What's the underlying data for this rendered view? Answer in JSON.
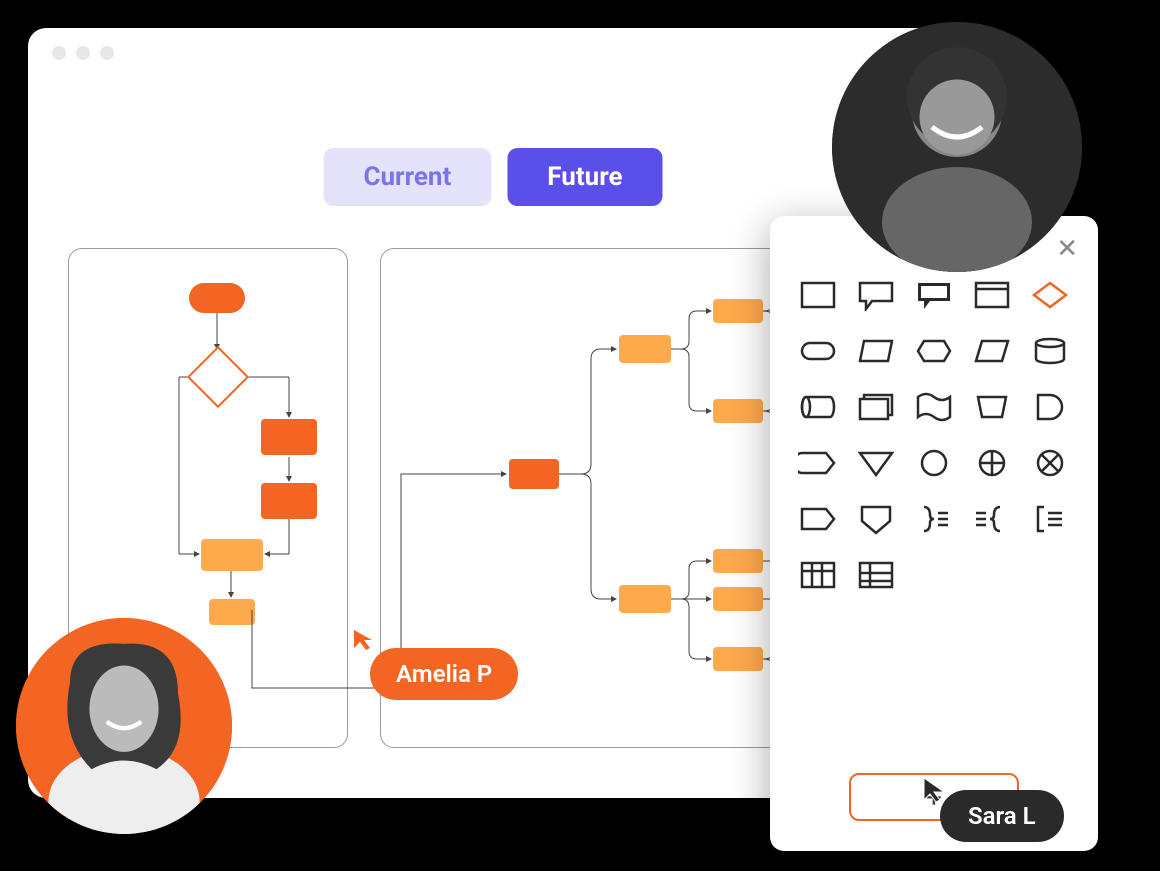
{
  "tabs": {
    "current": "Current",
    "future": "Future"
  },
  "cursors": {
    "amelia": "Amelia P",
    "sara": "Sara L"
  },
  "shapePanel": {
    "addLabel": "+",
    "closeLabel": "✕",
    "shapes": [
      "rectangle",
      "speech-bubble",
      "speech-bubble-filled",
      "card",
      "diamond",
      "rounded-rect",
      "trapezoid",
      "hexagon",
      "parallelogram",
      "cylinder",
      "can",
      "document-stack",
      "flag",
      "bucket",
      "half-circle",
      "tag",
      "triangle-down",
      "circle",
      "circle-cross",
      "circle-x",
      "pentagon-tag",
      "shield",
      "brace-right",
      "brace-left",
      "bracket",
      "grid-vertical",
      "grid-horizontal"
    ]
  },
  "avatars": {
    "top": "collaborator-1",
    "bottom": "collaborator-2"
  },
  "colors": {
    "accent": "#F26522",
    "primary": "#5B4FE9",
    "primaryLight": "#E5E3FB",
    "dark": "#2a2a2a"
  }
}
